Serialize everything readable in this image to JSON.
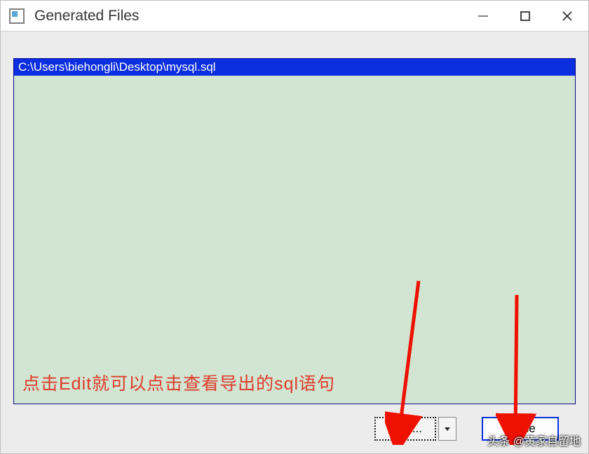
{
  "window": {
    "title": "Generated Files"
  },
  "list": {
    "selected_item": "C:\\Users\\biehongli\\Desktop\\mysql.sql"
  },
  "buttons": {
    "edit_label": "Edit ...",
    "close_label": "Close"
  },
  "annotation": {
    "text": "点击Edit就可以点击查看导出的sql语句"
  },
  "watermark": {
    "text": "头条 @黄家自留地"
  }
}
